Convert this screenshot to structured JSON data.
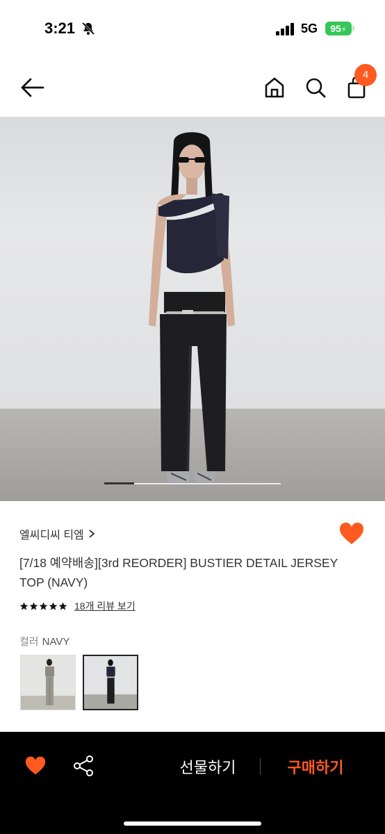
{
  "status_bar": {
    "time": "3:21",
    "network": "5G",
    "battery": "95"
  },
  "header": {
    "cart_count": "4"
  },
  "product": {
    "brand": "엘씨디씨 티엠",
    "title": "[7/18 예약배송][3rd REORDER] BUSTIER DETAIL JERSEY TOP (NAVY)",
    "rating": 5,
    "review_link": "18개 리뷰 보기",
    "option_label": "컬러",
    "option_value": "NAVY",
    "image_index_fraction": 0.17
  },
  "bottom_bar": {
    "gift_label": "선물하기",
    "buy_label": "구매하기"
  },
  "colors": {
    "accent": "#ff5a1f",
    "bottom_bg": "#000000"
  }
}
